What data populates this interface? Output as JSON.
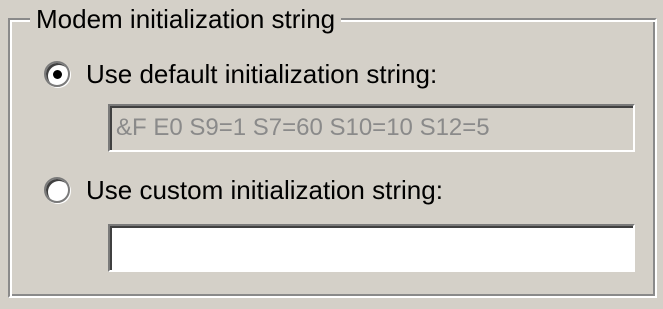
{
  "group": {
    "title": "Modem initialization string"
  },
  "options": [
    {
      "label": "Use default initialization string:",
      "selected": true,
      "field_value": "&F E0 S9=1 S7=60 S10=10 S12=5",
      "field_enabled": false
    },
    {
      "label": "Use custom initialization string:",
      "selected": false,
      "field_value": "",
      "field_enabled": true
    }
  ],
  "colors": {
    "dialog_bg": "#d4d0c8",
    "disabled_text": "#8a8a8a",
    "field_bg": "#ffffff"
  }
}
